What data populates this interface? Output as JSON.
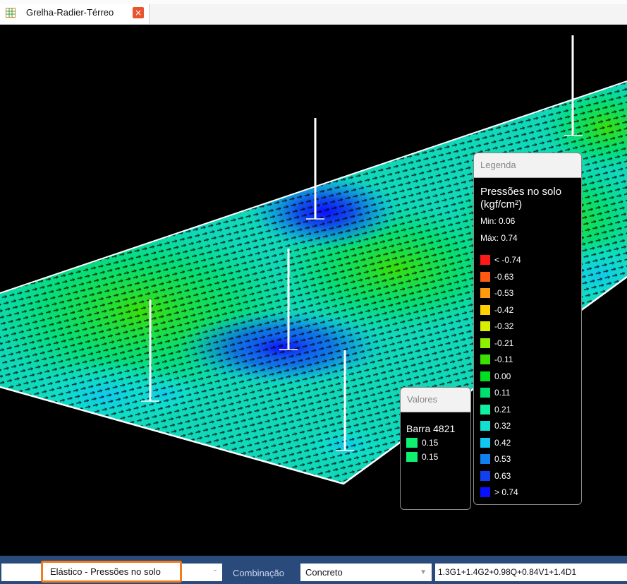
{
  "tab": {
    "title": "Grelha-Radier-Térreo",
    "close_glyph": "×"
  },
  "legend": {
    "header": "Legenda",
    "title_line1": "Pressões no solo",
    "title_line2": "(kgf/cm²)",
    "min": "Min: 0.06",
    "max": "Máx: 0.74",
    "items": [
      {
        "label": "< -0.74",
        "color": "#ff1a1a"
      },
      {
        "label": "-0.63",
        "color": "#ff5a10"
      },
      {
        "label": "-0.53",
        "color": "#ff9a10"
      },
      {
        "label": "-0.42",
        "color": "#ffd000"
      },
      {
        "label": "-0.32",
        "color": "#d8f000"
      },
      {
        "label": "-0.21",
        "color": "#8ef000"
      },
      {
        "label": "-0.11",
        "color": "#3ae000"
      },
      {
        "label": "0.00",
        "color": "#00e020"
      },
      {
        "label": "0.11",
        "color": "#00e070"
      },
      {
        "label": "0.21",
        "color": "#10f0a0"
      },
      {
        "label": "0.32",
        "color": "#10e0d0"
      },
      {
        "label": "0.42",
        "color": "#10c8f0"
      },
      {
        "label": "0.53",
        "color": "#1080f0"
      },
      {
        "label": "0.63",
        "color": "#1040f0"
      },
      {
        "label": "> 0.74",
        "color": "#0a10ff"
      }
    ]
  },
  "valores": {
    "header": "Valores",
    "bar_label": "Barra 4821",
    "values": [
      "0.15",
      "0.15"
    ],
    "color": "#0ef070"
  },
  "toolbar": {
    "analysis_value": "Elástico - Pressões no solo",
    "combination_label": "Combinação",
    "combination_value": "Concreto",
    "formula": "1.3G1+1.4G2+0.98Q+0.84V1+1.4D1",
    "accent": "#f07c1c",
    "background": "#2a4a7c"
  }
}
